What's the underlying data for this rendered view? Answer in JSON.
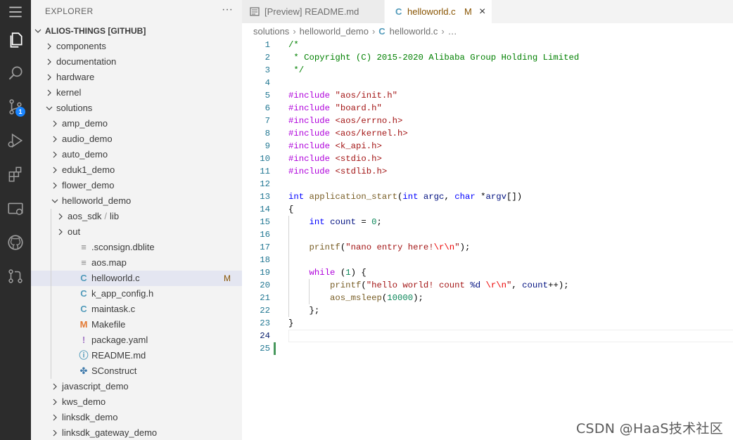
{
  "sidebar": {
    "header": "EXPLORER",
    "more": "···",
    "items": [
      {
        "label": "ALIOS-THINGS [GITHUB]",
        "type": "root"
      },
      {
        "label": "components",
        "type": "folder"
      },
      {
        "label": "documentation",
        "type": "folder"
      },
      {
        "label": "hardware",
        "type": "folder"
      },
      {
        "label": "kernel",
        "type": "folder"
      },
      {
        "label": "solutions",
        "type": "folder-open"
      },
      {
        "label": "amp_demo",
        "type": "folder"
      },
      {
        "label": "audio_demo",
        "type": "folder"
      },
      {
        "label": "auto_demo",
        "type": "folder"
      },
      {
        "label": "eduk1_demo",
        "type": "folder"
      },
      {
        "label": "flower_demo",
        "type": "folder"
      },
      {
        "label": "helloworld_demo",
        "type": "folder-open"
      },
      {
        "label": "aos_sdk",
        "label2": "lib",
        "type": "folder"
      },
      {
        "label": "out",
        "type": "folder"
      },
      {
        "label": ".sconsign.dblite",
        "type": "file",
        "icon": "lines-file-icon"
      },
      {
        "label": "aos.map",
        "type": "file",
        "icon": "lines-file-icon"
      },
      {
        "label": "helloworld.c",
        "type": "file",
        "icon": "c-file-icon",
        "badge": "M",
        "selected": true
      },
      {
        "label": "k_app_config.h",
        "type": "file",
        "icon": "c-header-icon"
      },
      {
        "label": "maintask.c",
        "type": "file",
        "icon": "c-file-icon"
      },
      {
        "label": "Makefile",
        "type": "file",
        "icon": "makefile-icon"
      },
      {
        "label": "package.yaml",
        "type": "file",
        "icon": "yaml-icon"
      },
      {
        "label": "README.md",
        "type": "file",
        "icon": "info-icon"
      },
      {
        "label": "SConstruct",
        "type": "file",
        "icon": "python-icon"
      },
      {
        "label": "javascript_demo",
        "type": "folder"
      },
      {
        "label": "kws_demo",
        "type": "folder"
      },
      {
        "label": "linksdk_demo",
        "type": "folder"
      },
      {
        "label": "linksdk_gateway_demo",
        "type": "folder"
      }
    ]
  },
  "activity": {
    "scm_badge": "1"
  },
  "tabs": [
    {
      "label": "[Preview] README.md"
    },
    {
      "label": "helloworld.c",
      "modified": "M",
      "close": "×"
    }
  ],
  "breadcrumb": [
    "solutions",
    "helloworld_demo",
    "helloworld.c",
    "…"
  ],
  "code": {
    "line_numbers": [
      "1",
      "2",
      "3",
      "4",
      "5",
      "6",
      "7",
      "8",
      "9",
      "10",
      "11",
      "12",
      "13",
      "14",
      "15",
      "16",
      "17",
      "18",
      "19",
      "20",
      "21",
      "22",
      "23",
      "24",
      "25"
    ]
  },
  "watermark": "CSDN @HaaS技术社区",
  "colors": {
    "activity_bg": "#2c2c2c",
    "sidebar_bg": "#f3f3f3",
    "selected_row": "#e4e6f1",
    "modified": "#895503",
    "c_icon": "#519aba",
    "makefile_icon": "#e37933",
    "yaml_icon": "#a074c4"
  }
}
